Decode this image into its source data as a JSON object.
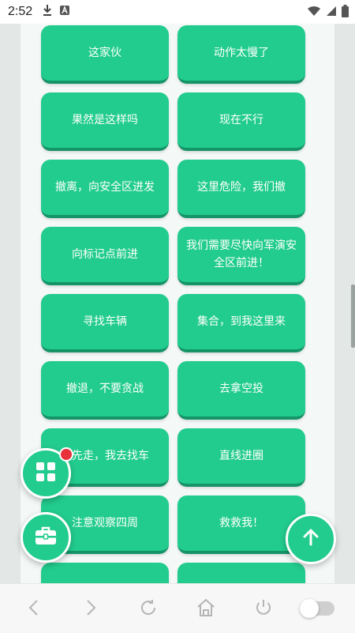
{
  "status_bar": {
    "time": "2:52",
    "icons": [
      "download-icon",
      "a-icon",
      "wifi-icon",
      "signal-icon",
      "battery-icon"
    ]
  },
  "phrases": [
    "这家伙",
    "动作太慢了",
    "果然是这样吗",
    "现在不行",
    "撤离，向安全区进发",
    "这里危险，我们撤",
    "向标记点前进",
    "我们需要尽快向军演安全区前进！",
    "寻找车辆",
    "集合，到我这里来",
    "撤退，不要贪战",
    "去拿空投",
    "我先走，我去找车",
    "直线进圈",
    "注意观察四周",
    "救救我！",
    "",
    ""
  ],
  "colors": {
    "card": "#22cc8e",
    "card_shadow": "#159468",
    "badge": "#e8323a",
    "background": "#e3e8e6"
  },
  "fabs": {
    "grid_icon": "grid-icon",
    "toolbox_icon": "toolbox-icon",
    "up_icon": "arrow-up-icon"
  },
  "nav_bar": {
    "icons": [
      "back-icon",
      "forward-icon",
      "refresh-icon",
      "home-icon",
      "power-icon",
      "toggle-switch"
    ]
  }
}
